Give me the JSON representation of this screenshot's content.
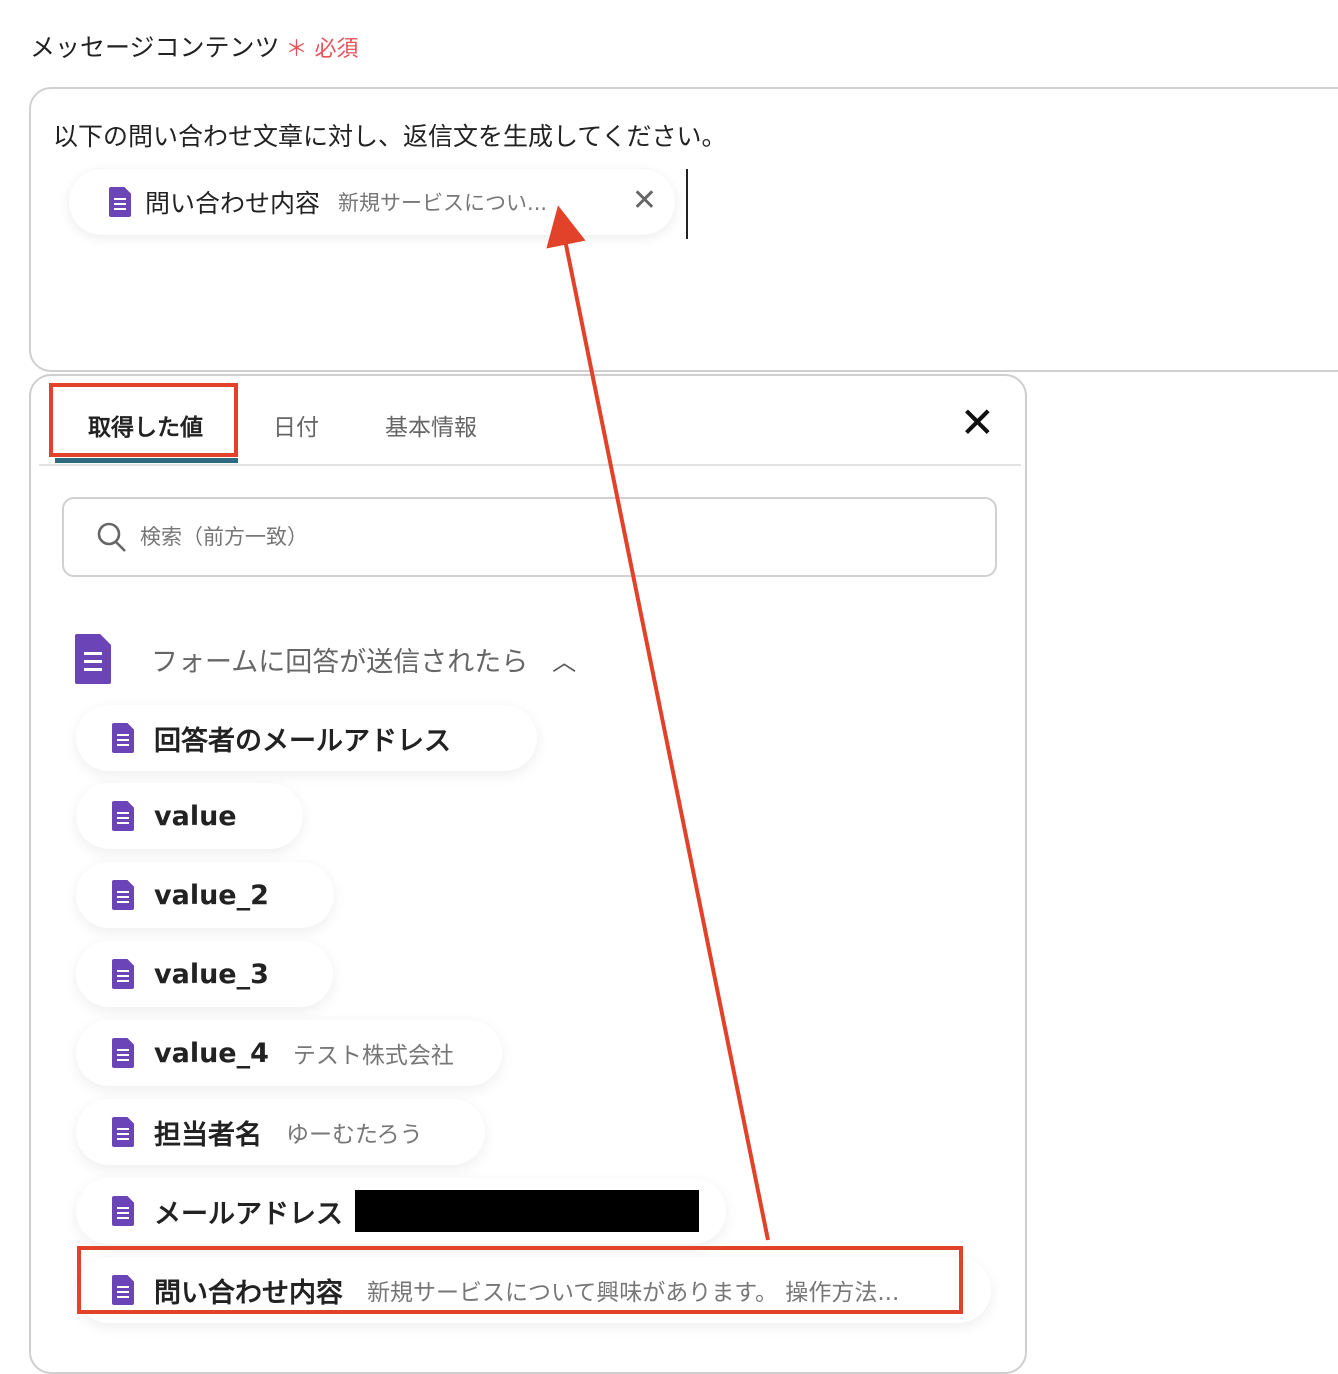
{
  "field": {
    "label": "メッセージコンテンツ",
    "required_mark": "＊",
    "required_text": "必須"
  },
  "editor": {
    "prompt": "以下の問い合わせ文章に対し、返信文を生成してください。",
    "chip": {
      "name": "問い合わせ内容",
      "value": "新規サービスについ...",
      "icon": "google-forms-icon",
      "remove_icon": "close-icon"
    }
  },
  "panel": {
    "tabs": [
      {
        "label": "取得した値",
        "active": true
      },
      {
        "label": "日付"
      },
      {
        "label": "基本情報"
      }
    ],
    "close_icon": "close-icon",
    "search": {
      "placeholder": "検索（前方一致）",
      "value": ""
    },
    "group": {
      "title": "フォームに回答が送信されたら",
      "expanded": true
    },
    "items": [
      {
        "name": "回答者のメールアドレス",
        "value": ""
      },
      {
        "name": "value",
        "value": ""
      },
      {
        "name": "value_2",
        "value": ""
      },
      {
        "name": "value_3",
        "value": ""
      },
      {
        "name": "value_4",
        "value": "テスト株式会社"
      },
      {
        "name": "担当者名",
        "value": "ゆーむたろう"
      },
      {
        "name": "メールアドレス",
        "value": ""
      },
      {
        "name": "問い合わせ内容",
        "value": "新規サービスについて興味があります。 操作方法..."
      }
    ]
  },
  "colors": {
    "accent_underline": "#2e6b80",
    "form_icon": "#6b45b8",
    "annotation": "#e2422a",
    "required": "#e8535a"
  }
}
